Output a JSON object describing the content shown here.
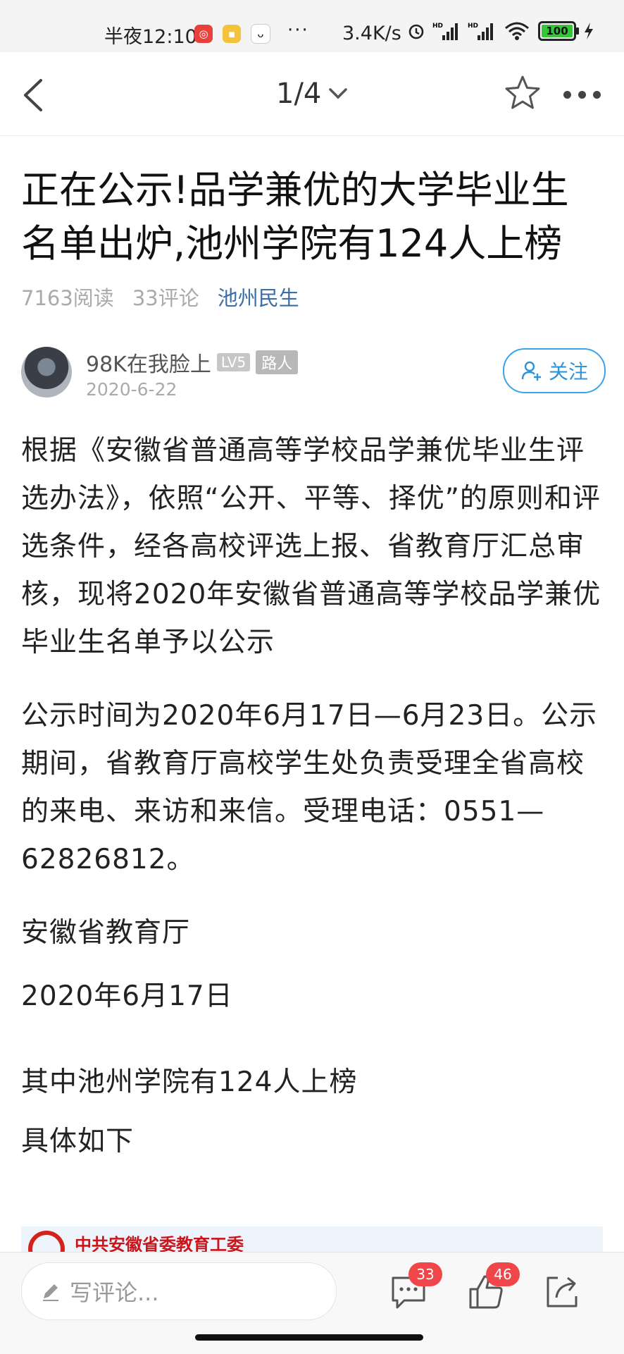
{
  "status_bar": {
    "time": "半夜12:10",
    "dots": "···",
    "speed": "3.4K/s",
    "battery": "100"
  },
  "nav": {
    "page_indicator": "1/4"
  },
  "article": {
    "title": "正在公示!品学兼优的大学毕业生名单出炉,池州学院有124人上榜",
    "reads": "7163阅读",
    "comments": "33评论",
    "channel": "池州民生",
    "author": {
      "name": "98K在我脸上",
      "level": "LV5",
      "role": "路人",
      "date": "2020-6-22",
      "follow_label": "关注"
    },
    "paragraphs": [
      "根据《安徽省普通高等学校品学兼优毕业生评选办法》，依照“公开、平等、择优”的原则和评选条件，经各高校评选上报、省教育厅汇总审核，现将2020年安徽省普通高等学校品学兼优毕业生名单予以公示",
      "公示时间为2020年6月17日—6月23日。公示期间，省教育厅高校学生处负责受理全省高校的来电、来访和来信。受理电话：0551—62826812。",
      "安徽省教育厅",
      "2020年6月17日",
      "其中池州学院有124人上榜",
      "具体如下"
    ],
    "image_caption": "中共安徽省委教育工委"
  },
  "bottom_bar": {
    "comment_placeholder": "写评论...",
    "comment_count": "33",
    "like_count": "46"
  }
}
